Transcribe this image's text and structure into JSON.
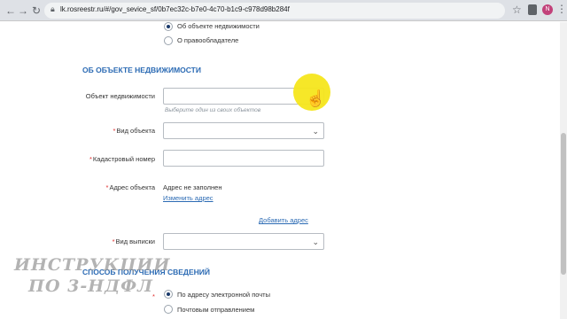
{
  "browser": {
    "url": "lk.rosreestr.ru/#/gov_sevice_sf/0b7ec32c-b7e0-4c70-b1c9-c978d98b284f",
    "avatar_letter": "N"
  },
  "about_radio": {
    "option_property": "Об объекте недвижимости",
    "option_owner": "О правообладателе"
  },
  "property_section": {
    "title": "ОБ ОБЪЕКТЕ НЕДВИЖИМОСТИ",
    "object_label": "Объект недвижимости",
    "object_hint": "Выберите один из своих объектов",
    "object_type_label": "Вид объекта",
    "cadastral_label": "Кадастровый номер",
    "address_label": "Адрес объекта",
    "address_value": "Адрес не заполнен",
    "change_address_link": "Изменить адрес",
    "add_address_link": "Добавить адрес",
    "extract_type_label": "Вид выписки"
  },
  "delivery_section": {
    "title": "СПОСОБ ПОЛУЧЕНИЯ СВЕДЕНИЙ",
    "option_email": "По адресу электронной почты",
    "option_post": "Почтовым отправлением"
  },
  "watermark": {
    "line1": "ИНСТРУКЦИИ",
    "line2": "ПО 3-НДФЛ"
  },
  "colors": {
    "accent": "#2c6bb4",
    "required": "#e02b2b",
    "highlight": "#f5e61c"
  }
}
